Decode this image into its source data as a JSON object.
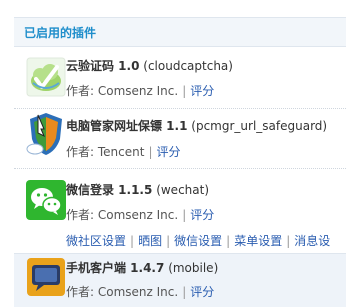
{
  "section_title": "已启用的插件",
  "plugins": [
    {
      "name": "云验证码 1.0",
      "id": "(cloudcaptcha)",
      "author_label": "作者:",
      "author": "Comsenz Inc.",
      "rate": "评分",
      "icon": "cloud-captcha-icon"
    },
    {
      "name": "电脑管家网址保镖 1.1",
      "id": "(pcmgr_url_safeguard)",
      "author_label": "作者:",
      "author": "Tencent",
      "rate": "评分",
      "icon": "pc-manager-shield-icon"
    },
    {
      "name": "微信登录 1.1.5",
      "id": "(wechat)",
      "author_label": "作者:",
      "author": "Comsenz Inc.",
      "rate": "评分",
      "icon": "wechat-icon",
      "links": [
        "微社区设置",
        "晒图",
        "微信设置",
        "菜单设置",
        "消息设"
      ]
    },
    {
      "name": "手机客户端 1.4.7",
      "id": "(mobile)",
      "author_label": "作者:",
      "author": "Comsenz Inc.",
      "rate": "评分",
      "icon": "mobile-client-icon"
    }
  ]
}
